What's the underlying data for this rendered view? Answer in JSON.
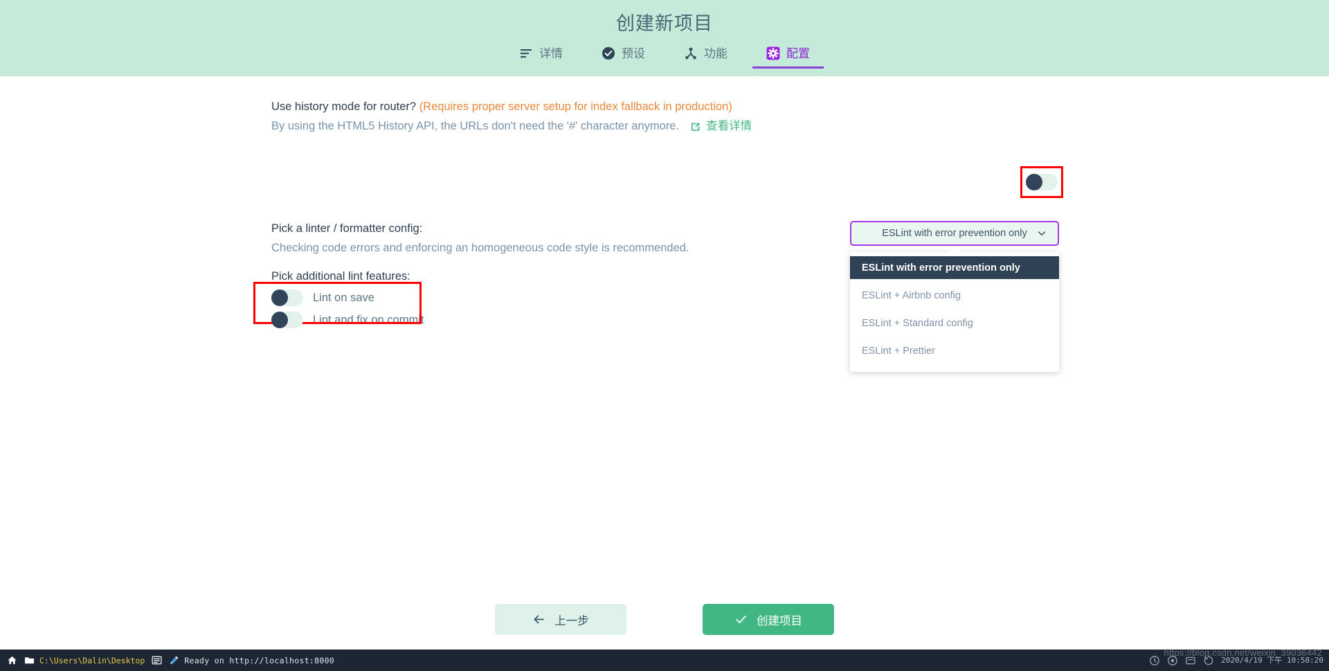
{
  "header": {
    "title": "创建新项目",
    "tabs": [
      {
        "label": "详情",
        "icon": "list-icon",
        "active": false
      },
      {
        "label": "预设",
        "icon": "check-circle-icon",
        "active": false
      },
      {
        "label": "功能",
        "icon": "people-icon",
        "active": false
      },
      {
        "label": "配置",
        "icon": "gear-icon",
        "active": true
      }
    ]
  },
  "main": {
    "history": {
      "question": "Use history mode for router?",
      "warning": "(Requires proper server setup for index fallback in production)",
      "description": "By using the HTML5 History API, the URLs don't need the '#' character anymore.",
      "link_label": "查看详情",
      "toggle_state": "off"
    },
    "linter": {
      "title": "Pick a linter / formatter config:",
      "description": "Checking code errors and enforcing an homogeneous code style is recommended.",
      "selected": "ESLint with error prevention only",
      "options": [
        "ESLint with error prevention only",
        "ESLint + Airbnb config",
        "ESLint + Standard config",
        "ESLint + Prettier"
      ]
    },
    "lint_features": {
      "title": "Pick additional lint features:",
      "items": [
        {
          "label": "Lint on save",
          "state": "off"
        },
        {
          "label": "Lint and fix on commit",
          "state": "off"
        }
      ]
    }
  },
  "footer": {
    "prev_label": "上一步",
    "create_label": "创建项目"
  },
  "taskbar": {
    "path": "C:\\Users\\Dalin\\Desktop",
    "status": "Ready on http://localhost:8000",
    "clock_date": "2020/4/19",
    "clock_time": "下午 10:58:20",
    "watermark": "https://blog.csdn.net/weixin_39036442"
  },
  "colors": {
    "header_bg": "#c6ead9",
    "accent_purple": "#8c3fd6",
    "accent_green": "#41b883",
    "warning_orange": "#e8883a",
    "annotation_red": "#fe0000",
    "menu_selected_bg": "#2f4154",
    "toggle_knob": "#324459"
  }
}
